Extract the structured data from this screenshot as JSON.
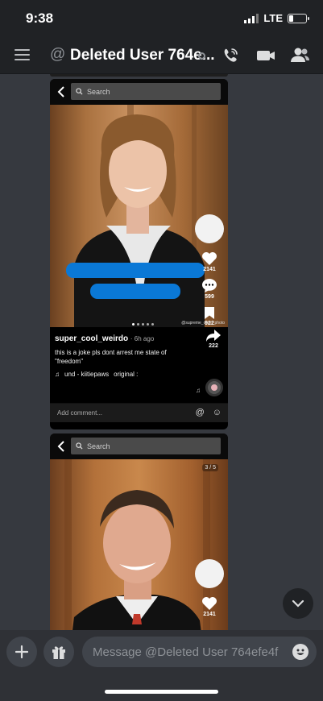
{
  "status_bar": {
    "time": "9:38",
    "network": "LTE",
    "signal_bars": 3,
    "battery_level": 0.25
  },
  "header": {
    "title": "Deleted User 764e...",
    "icons": [
      "menu-icon",
      "at-icon",
      "call-icon",
      "video-icon",
      "members-icon"
    ]
  },
  "post1": {
    "search_placeholder": "Search",
    "counts": {
      "likes": "2141",
      "comments": "599",
      "saves": "922",
      "shares": "222"
    },
    "watermark": "@supreme_court_photo",
    "author": "super_cool_weirdo",
    "time": "· 6h ago",
    "caption": "this is a joke pls dont arrest me state of \"freedom\"",
    "music_a": "und - kiitiepaws",
    "music_b": "original :",
    "comment_placeholder": "Add comment..."
  },
  "post2": {
    "search_placeholder": "Search",
    "image_counter": "3 / 5",
    "counts": {
      "likes": "2141"
    }
  },
  "composer": {
    "placeholder": "Message @Deleted User 764efe4f"
  },
  "colors": {
    "background": "#36393f",
    "header": "#202225",
    "redaction": "#0a78d6"
  }
}
